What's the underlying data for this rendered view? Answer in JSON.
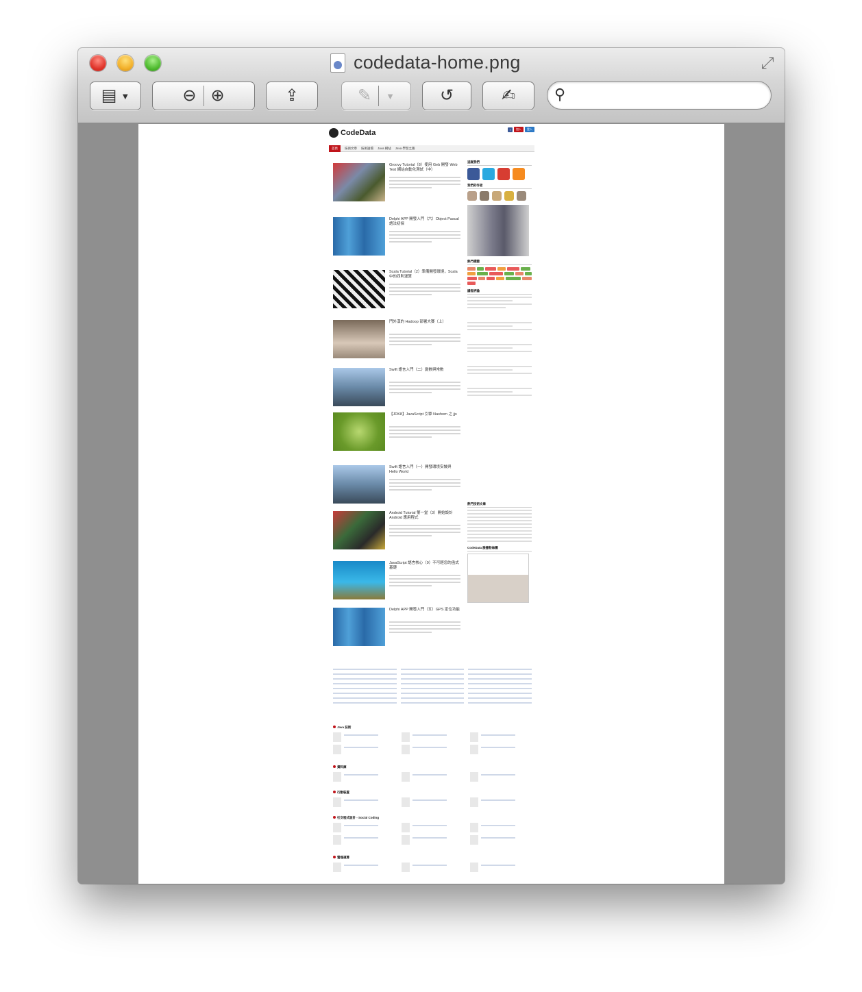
{
  "window": {
    "title": "codedata-home.png"
  },
  "toolbar": {
    "buttons": [
      {
        "name": "sidebar-toggle",
        "icon": "sidebar-icon"
      },
      {
        "name": "zoom-out",
        "icon": "zoom-out-icon"
      },
      {
        "name": "zoom-in",
        "icon": "zoom-in-icon"
      },
      {
        "name": "share",
        "icon": "share-icon"
      },
      {
        "name": "annotate",
        "icon": "pen-icon"
      },
      {
        "name": "rotate",
        "icon": "rotate-icon"
      },
      {
        "name": "edit",
        "icon": "edit-icon"
      }
    ],
    "search_placeholder": ""
  },
  "document": {
    "site_name": "CodeData",
    "nav": [
      "首頁",
      "技術文章",
      "技術論壇",
      "Java 綱站",
      "Java 學習之路"
    ],
    "posts": [
      "Groovy Tutorial（8）使用 Geb 開發 Web Test 網站自動化測試（中）",
      "Delphi APP 開發入門（六）Object Pascal 語法初探",
      "Scala Tutorial（2）準備開發環境，Scala 中的四則運算",
      "門外漢的 Hadoop 部署大賽（上）",
      "Swift 語言入門（二）變數與常數",
      "【JDK8】JavaScript 引擎 Nashorn 之 jjs",
      "Swift 語言入門（一）開發環境安裝與 Hello World",
      "Android Tutorial 第一堂（3）開始設計 Android 應用程式",
      "JavaScript 語言核心（9）不可輕忽的函式基礎",
      "Delphi APP 開發入門（五）GPS 定位功能"
    ],
    "sidebar": [
      "追蹤我們",
      "我們的作者",
      "熱門標籤",
      "讀者評論",
      "熱門技術文章",
      "CodeData 臉書粉絲團"
    ],
    "footer_sections": [
      "Java 技術",
      "資料庫",
      "行動裝置",
      "社交程式設計 - Social Coding",
      "雲端運算"
    ]
  },
  "colors": {
    "accent": "#c0141a",
    "viewer_bg": "#8f8f8f"
  }
}
